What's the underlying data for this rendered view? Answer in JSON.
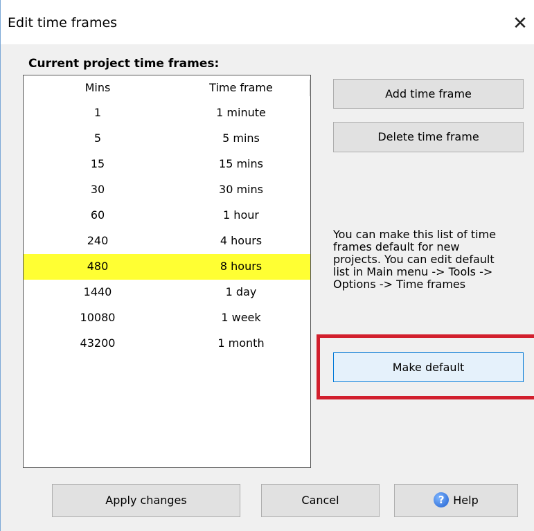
{
  "dialog": {
    "title": "Edit time frames",
    "close_glyph": "✕"
  },
  "list": {
    "label": "Current project time frames:",
    "columns": [
      "Mins",
      "Time frame"
    ],
    "rows": [
      {
        "mins": "1",
        "frame": "1 minute"
      },
      {
        "mins": "5",
        "frame": "5 mins"
      },
      {
        "mins": "15",
        "frame": "15 mins"
      },
      {
        "mins": "30",
        "frame": "30 mins"
      },
      {
        "mins": "60",
        "frame": "1 hour"
      },
      {
        "mins": "240",
        "frame": "4 hours"
      },
      {
        "mins": "480",
        "frame": "8 hours"
      },
      {
        "mins": "1440",
        "frame": "1 day"
      },
      {
        "mins": "10080",
        "frame": "1 week"
      },
      {
        "mins": "43200",
        "frame": "1 month"
      }
    ],
    "highlight_color": "#ffff33"
  },
  "buttons": {
    "add": "Add time frame",
    "delete": "Delete time frame",
    "make_default": "Make default",
    "apply": "Apply changes",
    "cancel": "Cancel",
    "help": "Help",
    "help_icon_glyph": "?"
  },
  "info_lines": [
    "You can make this list of time",
    "frames default for new",
    "projects. You can edit default",
    "list in Main menu -> Tools ->",
    "Options -> Time frames"
  ],
  "icons": {
    "close": "close-icon",
    "help": "help-icon"
  },
  "colors": {
    "highlight_frame": "#d21f2d",
    "default_button_border": "#0078d7"
  }
}
